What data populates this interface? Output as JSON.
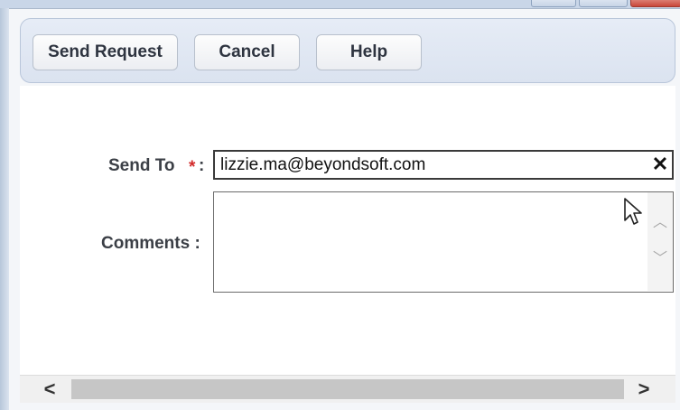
{
  "toolbar": {
    "send_label": "Send Request",
    "cancel_label": "Cancel",
    "help_label": "Help"
  },
  "form": {
    "send_to": {
      "label": "Send To",
      "required_marker": "*",
      "colon": ":",
      "value": "lizzie.ma@beyondsoft.com",
      "clear_glyph": "✕"
    },
    "comments": {
      "label": "Comments :",
      "value": ""
    }
  },
  "scrollbars": {
    "textarea_up": "︿",
    "textarea_down": "﹀",
    "horizontal_left": "<",
    "horizontal_right": ">"
  },
  "icons": {
    "cursor": "mouse-pointer-icon"
  }
}
